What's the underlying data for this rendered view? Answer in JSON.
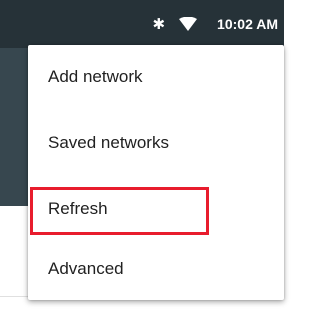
{
  "status_bar": {
    "time": "10:02 AM",
    "bluetooth_glyph": "✱",
    "icons": [
      "bluetooth-icon",
      "wifi-icon"
    ]
  },
  "menu": {
    "items": [
      {
        "label": "Add network"
      },
      {
        "label": "Saved networks"
      },
      {
        "label": "Refresh"
      },
      {
        "label": "Advanced"
      }
    ]
  },
  "colors": {
    "status_bar": "#263238",
    "app_bar": "#37474f",
    "menu_background": "#ffffff",
    "menu_text": "#212121",
    "highlight": "#e81c2d"
  }
}
